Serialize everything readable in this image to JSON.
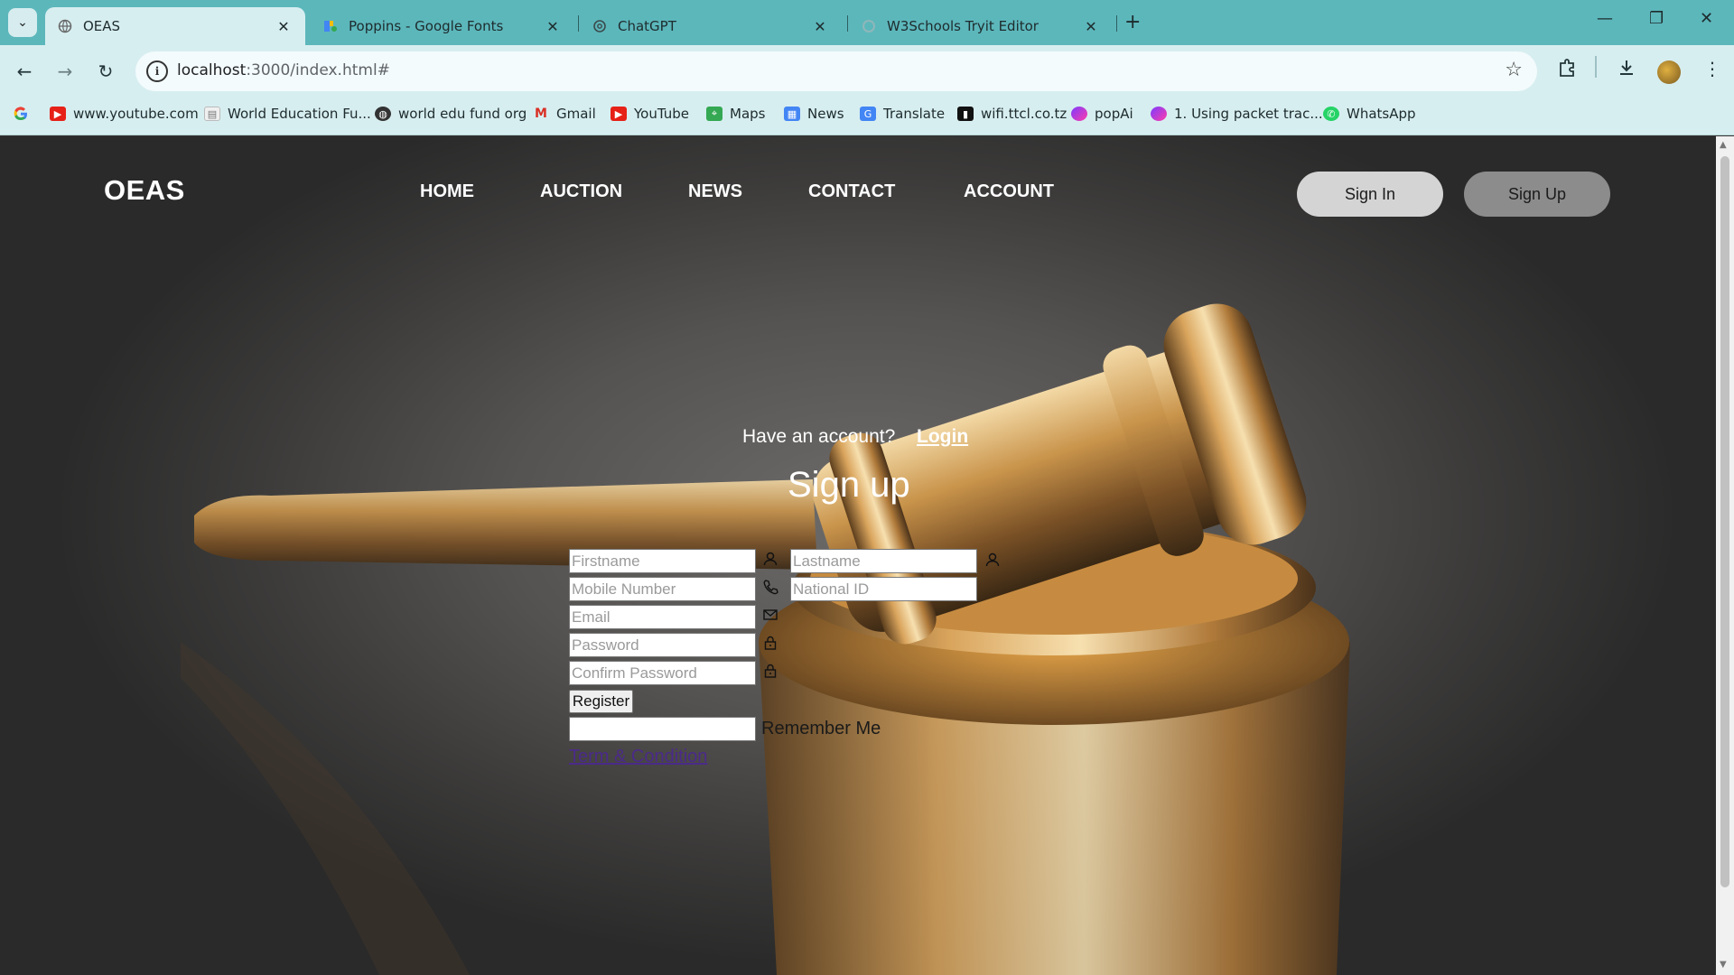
{
  "browser": {
    "tabs": [
      {
        "title": "OEAS",
        "active": true
      },
      {
        "title": "Poppins - Google Fonts",
        "active": false
      },
      {
        "title": "ChatGPT",
        "active": false
      },
      {
        "title": "W3Schools Tryit Editor",
        "active": false
      }
    ],
    "url_host": "localhost",
    "url_rest": ":3000/index.html#",
    "bookmarks": [
      {
        "label": "www.youtube.com",
        "icon": "youtube-icon"
      },
      {
        "label": "World Education Fu...",
        "icon": "page-icon"
      },
      {
        "label": "world edu fund org",
        "icon": "globe-icon"
      },
      {
        "label": "Gmail",
        "icon": "gmail-icon"
      },
      {
        "label": "YouTube",
        "icon": "youtube-icon"
      },
      {
        "label": "Maps",
        "icon": "maps-icon"
      },
      {
        "label": "News",
        "icon": "news-icon"
      },
      {
        "label": "Translate",
        "icon": "translate-icon"
      },
      {
        "label": "wifi.ttcl.co.tz",
        "icon": "wifi-icon"
      },
      {
        "label": "popAi",
        "icon": "popai-icon"
      },
      {
        "label": "1. Using packet trac...",
        "icon": "popai-icon"
      },
      {
        "label": "WhatsApp",
        "icon": "whatsapp-icon"
      }
    ]
  },
  "site": {
    "brand": "OEAS",
    "nav": [
      "HOME",
      "AUCTION",
      "NEWS",
      "CONTACT",
      "ACCOUNT"
    ],
    "sign_in": "Sign In",
    "sign_up": "Sign Up"
  },
  "form": {
    "have_account": "Have an account?",
    "login_link": "Login",
    "title": "Sign up",
    "firstname_ph": "Firstname",
    "lastname_ph": "Lastname",
    "mobile_ph": "Mobile Number",
    "national_id_ph": "National ID",
    "email_ph": "Email",
    "password_ph": "Password",
    "confirm_ph": "Confirm Password",
    "register": "Register",
    "remember": "Remember Me",
    "terms": "Term & Condition"
  },
  "colors": {
    "tabbar": "#5cb7bb",
    "toolbar": "#d7eef0",
    "pill_signin": "#d4d4d4",
    "pill_signup": "#8c8c8c",
    "terms_link": "#4b2a8a"
  }
}
